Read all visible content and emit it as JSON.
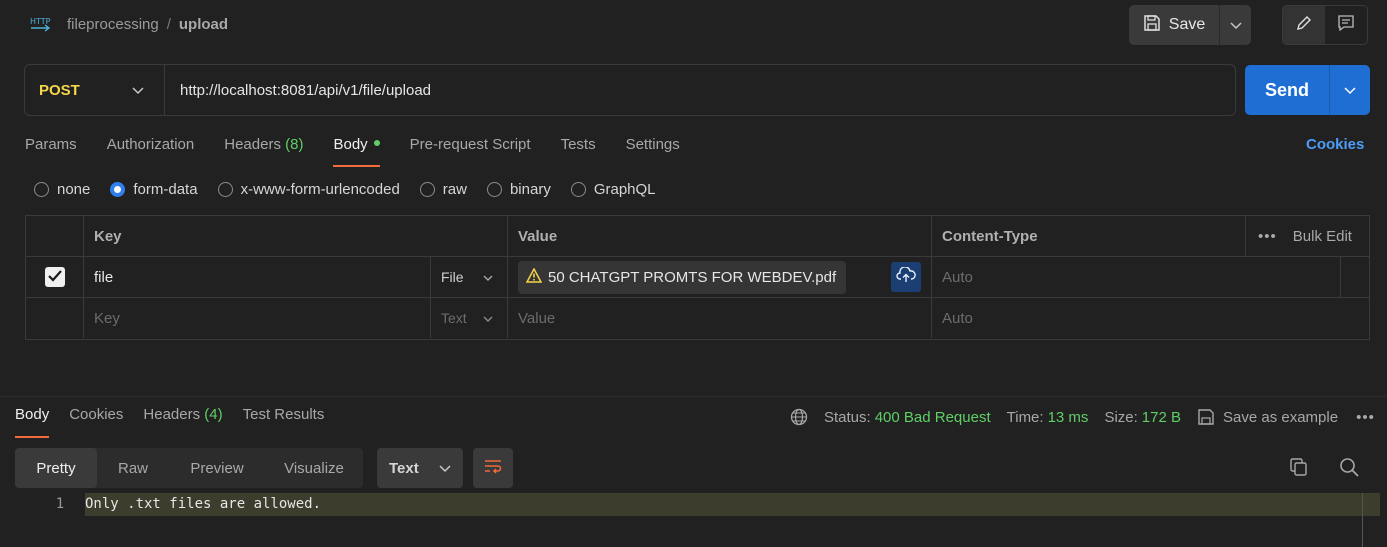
{
  "breadcrumb": {
    "parent": "fileprocessing",
    "separator": "/",
    "current": "upload"
  },
  "toolbar": {
    "save_label": "Save"
  },
  "request": {
    "method": "POST",
    "url": "http://localhost:8081/api/v1/file/upload",
    "send_label": "Send"
  },
  "req_tabs": {
    "params": "Params",
    "authorization": "Authorization",
    "headers": "Headers",
    "headers_count": "(8)",
    "body": "Body",
    "prerequest": "Pre-request Script",
    "tests": "Tests",
    "settings": "Settings",
    "cookies": "Cookies"
  },
  "body_types": {
    "none": "none",
    "form_data": "form-data",
    "urlencoded": "x-www-form-urlencoded",
    "raw": "raw",
    "binary": "binary",
    "graphql": "GraphQL"
  },
  "table": {
    "headers": {
      "key": "Key",
      "value": "Value",
      "content_type": "Content-Type",
      "bulk_edit": "Bulk Edit"
    },
    "row1": {
      "key": "file",
      "type": "File",
      "value": "50 CHATGPT PROMTS FOR WEBDEV.pdf",
      "content_type": "Auto"
    },
    "row2": {
      "key_placeholder": "Key",
      "type": "Text",
      "value_placeholder": "Value",
      "content_type_placeholder": "Auto"
    }
  },
  "response": {
    "tabs": {
      "body": "Body",
      "cookies": "Cookies",
      "headers": "Headers",
      "headers_count": "(4)",
      "test_results": "Test Results"
    },
    "status_label": "Status:",
    "status_value": "400 Bad Request",
    "time_label": "Time:",
    "time_value": "13 ms",
    "size_label": "Size:",
    "size_value": "172 B",
    "save_example": "Save as example",
    "views": {
      "pretty": "Pretty",
      "raw": "Raw",
      "preview": "Preview",
      "visualize": "Visualize"
    },
    "format": "Text",
    "line_number": "1",
    "body_text": "Only .txt files are allowed."
  },
  "colors": {
    "accent_orange": "#f26b3a",
    "send_blue": "#1f6ed4",
    "method_yellow": "#f5d54a",
    "status_green": "#5fcf65",
    "cookies_blue": "#4d9cf7"
  }
}
